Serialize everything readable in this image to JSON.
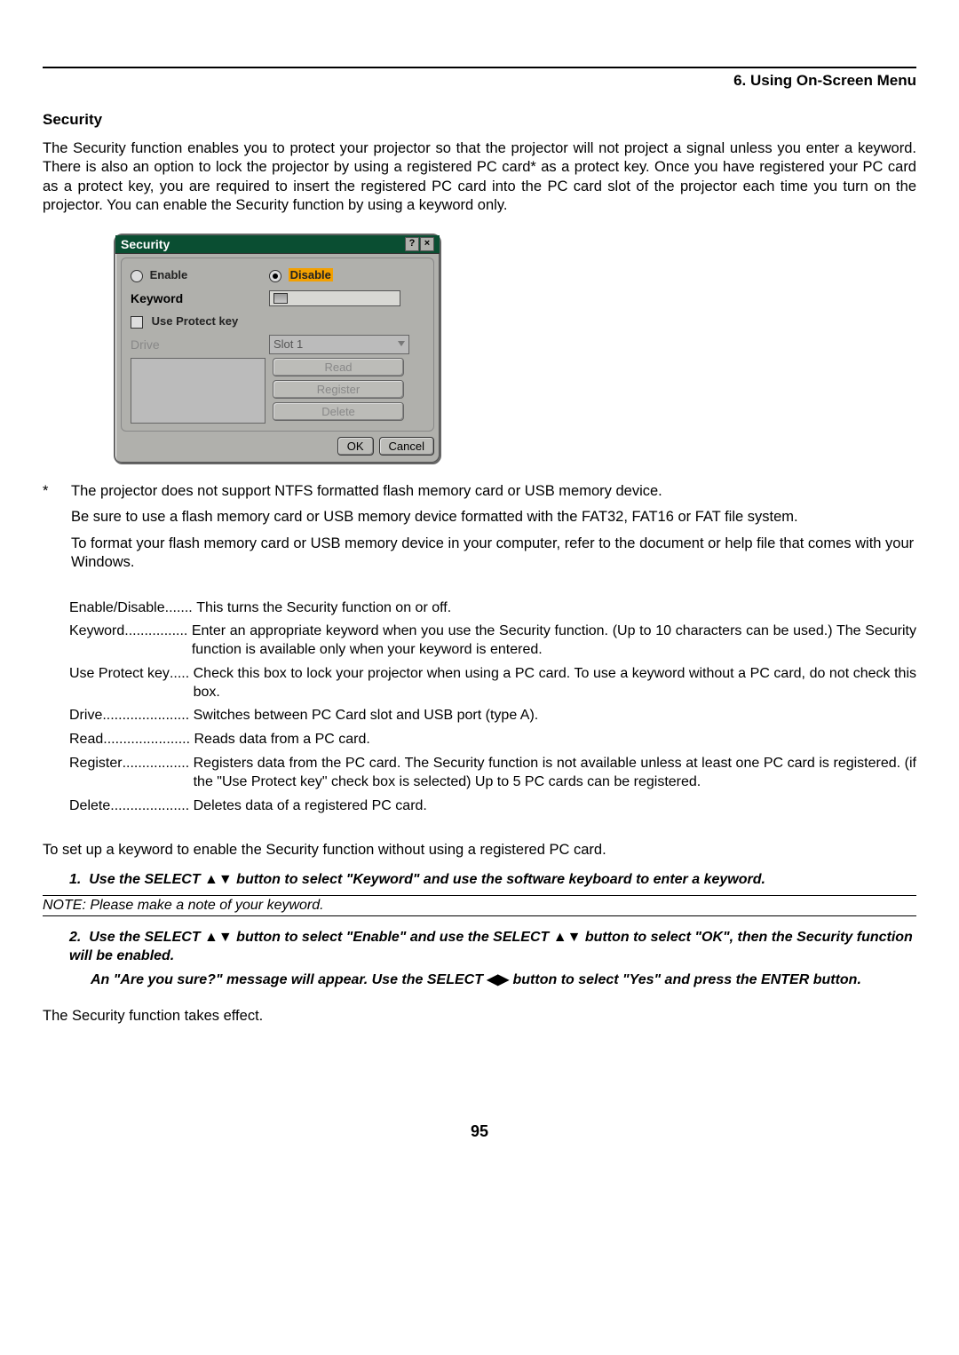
{
  "chapter": "6. Using On-Screen Menu",
  "section_heading": "Security",
  "intro_para": "The Security function enables you to protect your projector so that the projector will not project a signal unless you enter a keyword. There is also an option to lock the projector by using a registered PC card* as a protect key. Once you have registered your PC card as a protect key, you are required to insert the registered PC card into the PC card slot of the projector each time you turn on the projector. You can enable the Security function by using a keyword only.",
  "dialog": {
    "title": "Security",
    "enable_label": "Enable",
    "disable_label": "Disable",
    "keyword_label": "Keyword",
    "use_protect_label": "Use Protect key",
    "drive_label": "Drive",
    "drive_value": "Slot 1",
    "btn_read": "Read",
    "btn_register": "Register",
    "btn_delete": "Delete",
    "btn_ok": "OK",
    "btn_cancel": "Cancel"
  },
  "notes": {
    "n1": "The projector does not support NTFS formatted flash memory card or USB memory device.",
    "n2": "Be sure to use a flash memory card or USB memory device formatted with the FAT32, FAT16 or FAT file system.",
    "n3": "To format your flash memory card or USB memory device in your computer, refer to the document or help file that comes with your Windows."
  },
  "defs": {
    "d1_term": "Enable/Disable",
    "d1_dots": " .......",
    "d1_desc": "This turns the Security function on or off.",
    "d2_term": "Keyword",
    "d2_dots": " ................",
    "d2_desc": "Enter an appropriate keyword when you use the Security function. (Up to 10 characters can be used.) The Security function is available only when your keyword is entered.",
    "d3_term": "Use Protect key",
    "d3_dots": " .....",
    "d3_desc": "Check this box to lock your projector when using a PC card. To use a keyword without a PC card, do not check this box.",
    "d4_term": "Drive",
    "d4_dots": "......................",
    "d4_desc": "Switches between PC Card slot and USB port (type A).",
    "d5_term": "Read",
    "d5_dots": " ......................",
    "d5_desc": "Reads data from a PC card.",
    "d6_term": "Register",
    "d6_dots": " .................",
    "d6_desc": "Registers data from the PC card. The Security function is not available unless at least one PC card is registered. (if the \"Use Protect key\" check box is selected) Up to 5 PC cards can be registered.",
    "d7_term": "Delete",
    "d7_dots": " ....................",
    "d7_desc": "Deletes data of a registered PC card."
  },
  "steps_lead": "To set up a keyword to enable the Security function without using a registered PC card.",
  "step1_num": "1.",
  "step1_a": "Use the SELECT ",
  "step1_b": " button to select \"Keyword\" and use the software keyboard to enter a keyword.",
  "note_keyword": "NOTE: Please make a note of your keyword.",
  "step2_num": "2.",
  "step2_a": "Use the SELECT ",
  "step2_b": " button to select \"Enable\" and use the SELECT ",
  "step2_c": " button to select \"OK\", then the Security function will be enabled.",
  "step2_sub_a": "An \"Are you sure?\" message will appear. Use the SELECT ",
  "step2_sub_b": " button to select \"Yes\" and press the ENTER button.",
  "effect_line": "The Security function takes effect.",
  "page_number": "95"
}
